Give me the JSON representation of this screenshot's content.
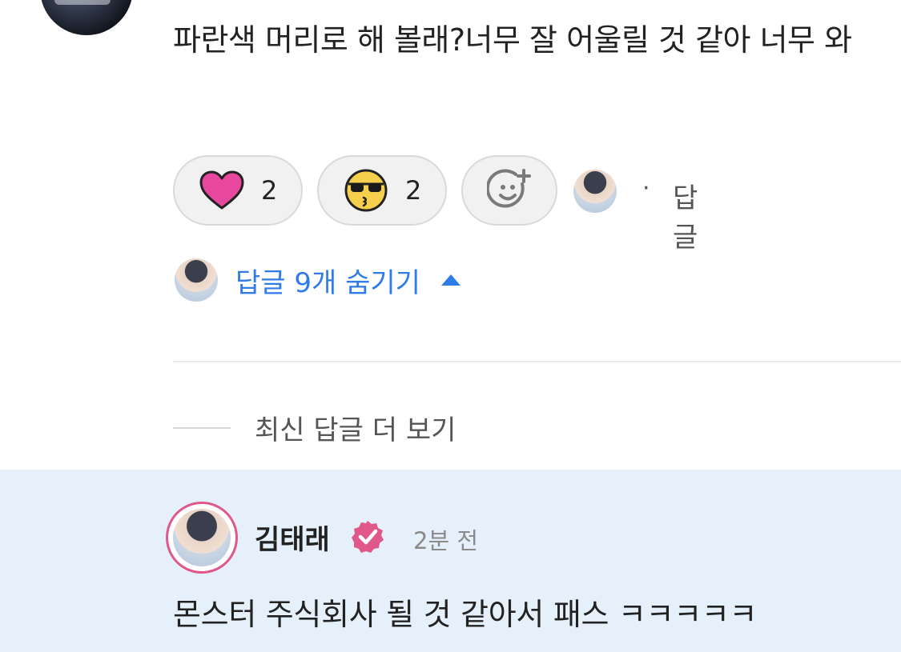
{
  "comment": {
    "text": "파란색 머리로 해 볼래?너무 잘 어울릴 것 같아 너무 와"
  },
  "reactions": {
    "heart_count": "2",
    "emoji_count": "2",
    "separator": "·",
    "reply_label": "답글",
    "colors": {
      "heart": "#e8479e",
      "emoji_face": "#f6d04d"
    }
  },
  "replies_toggle": {
    "label": "답글 9개 숨기기",
    "icon": "caret-up-icon",
    "color": "#2f7be8"
  },
  "more_replies": {
    "label": "최신 답글 더 보기"
  },
  "highlighted_reply": {
    "author": "김태래",
    "badge_icon": "verified-badge-icon",
    "time": "2분 전",
    "text": "몬스터 주식회사 될 것 같아서 패스 ㅋㅋㅋㅋㅋ",
    "colors": {
      "background": "#e6f0fb",
      "badge": "#e0588a"
    }
  }
}
